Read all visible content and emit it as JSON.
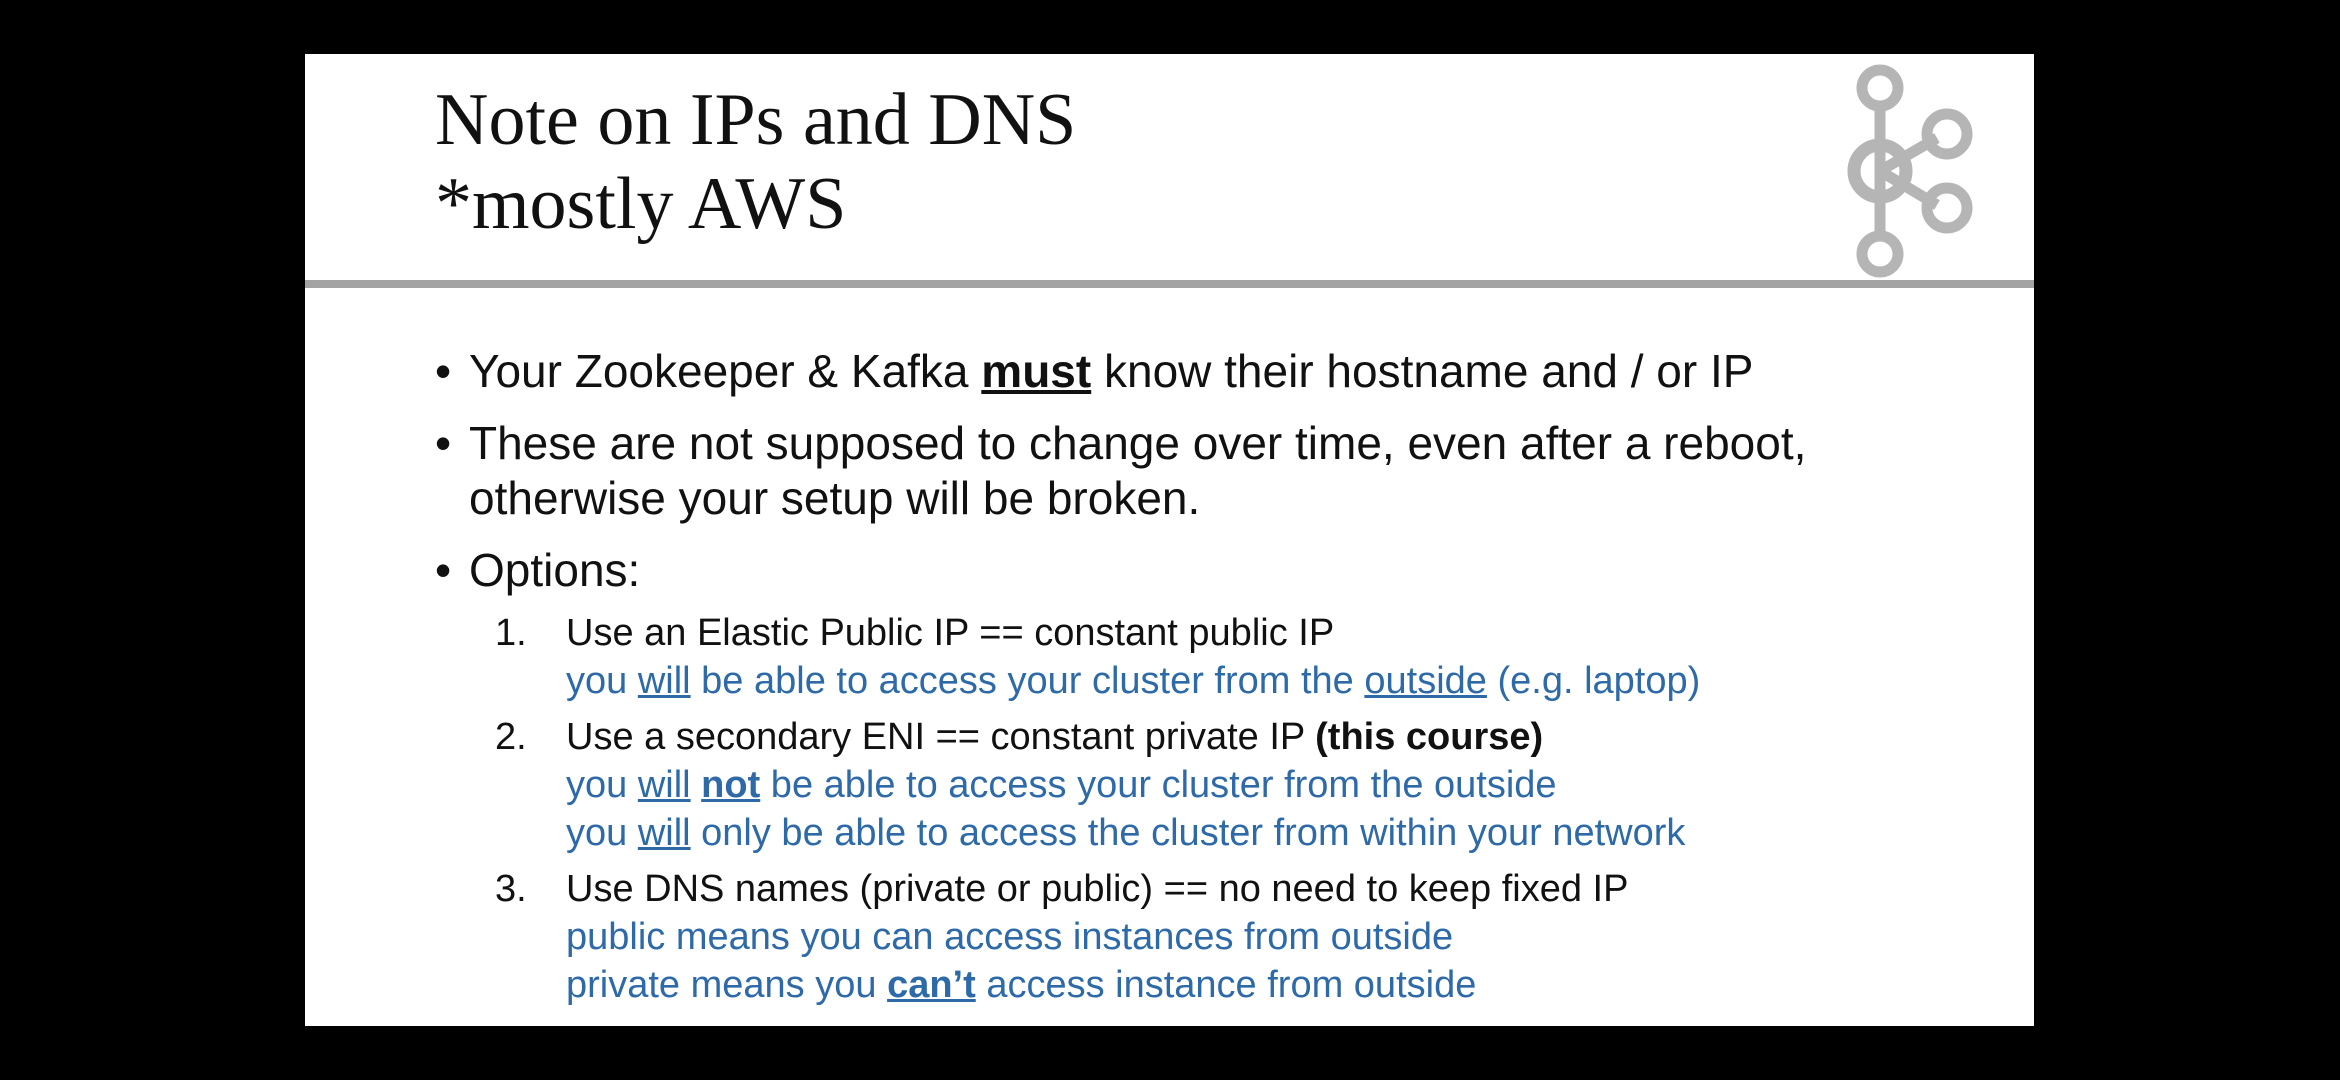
{
  "slide": {
    "title_line1": "Note on IPs and DNS",
    "title_line2": "*mostly AWS",
    "logo_icon": "kafka-logo-icon",
    "colors": {
      "background": "#000000",
      "slide": "#ffffff",
      "rule": "#a3a3a3",
      "logo": "#b5b5b5",
      "accent_text": "#2e6aa8"
    },
    "bullets": [
      {
        "pre": "Your Zookeeper & Kafka ",
        "emph": "must",
        "post": " know their hostname and / or IP"
      },
      {
        "line1": "These are not supposed to change over time, even after a reboot,",
        "line2": "otherwise your setup will be broken."
      },
      {
        "text": "Options:"
      }
    ],
    "options": [
      {
        "number": "1.",
        "main": "Use an Elastic Public IP == constant public IP",
        "sub1_a": "you ",
        "sub1_b": "will",
        "sub1_c": " be able to access your cluster from the ",
        "sub1_d": "outside",
        "sub1_e": " (e.g. laptop)"
      },
      {
        "number": "2.",
        "main": "Use a secondary ENI == constant private IP ",
        "main_bold": "(this course)",
        "sub1_a": "you ",
        "sub1_b": "will",
        "sub1_c": " ",
        "sub1_d": "not",
        "sub1_e": " be able to access your cluster from the outside",
        "sub2_a": "you ",
        "sub2_b": "will",
        "sub2_c": " only be able to access the cluster from within your network"
      },
      {
        "number": "3.",
        "main": "Use DNS names (private or public) == no need to keep fixed IP",
        "sub1": "public means you can access instances from outside",
        "sub2_a": "private means you ",
        "sub2_b": "can’t",
        "sub2_c": " access instance from outside"
      }
    ]
  }
}
